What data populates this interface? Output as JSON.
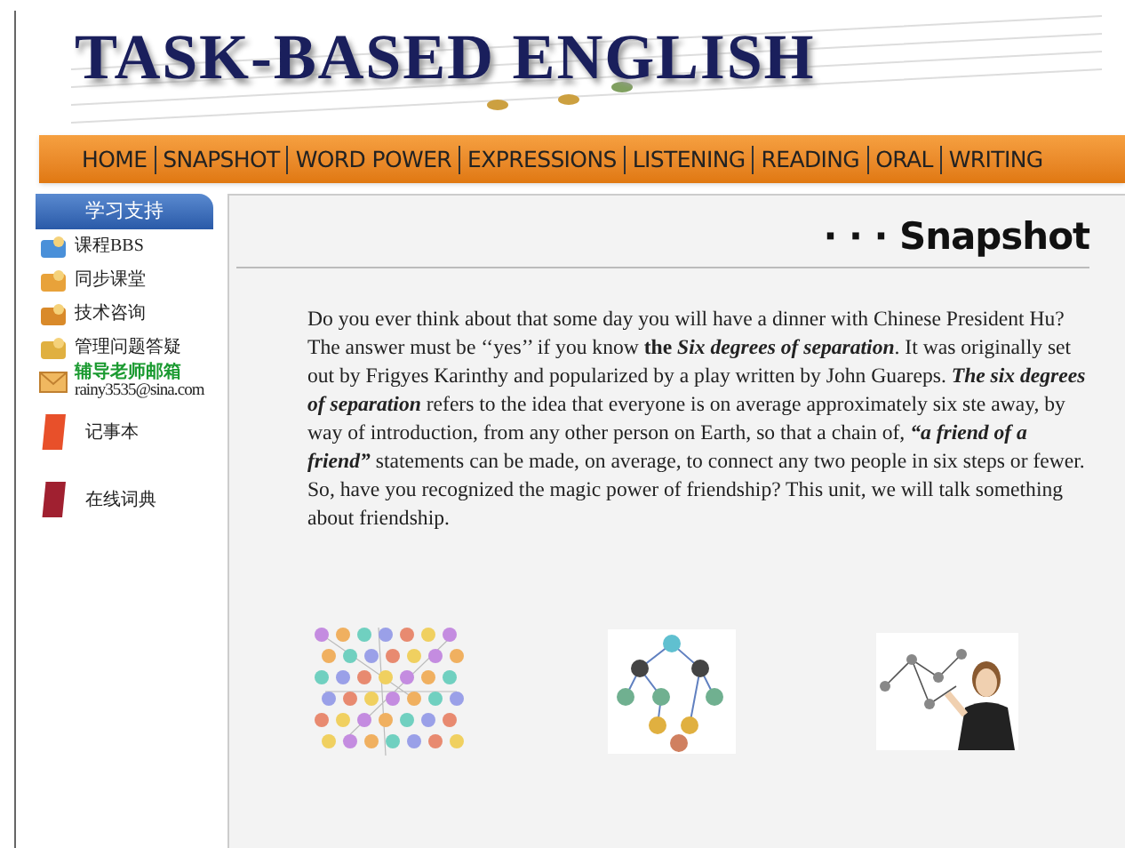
{
  "header": {
    "title": "TASK-BASED ENGLISH"
  },
  "nav": [
    {
      "label": "HOME"
    },
    {
      "label": "SNAPSHOT"
    },
    {
      "label": "WORD POWER"
    },
    {
      "label": "EXPRESSIONS"
    },
    {
      "label": "LISTENING"
    },
    {
      "label": "READING"
    },
    {
      "label": "ORAL"
    },
    {
      "label": "WRITING"
    }
  ],
  "sidebar": {
    "heading": "学习支持",
    "items": [
      {
        "kind": "link",
        "label": "课程BBS",
        "color": "#4a90d9"
      },
      {
        "kind": "link",
        "label": "同步课堂",
        "color": "#e8a23a"
      },
      {
        "kind": "link",
        "label": "技术咨询",
        "color": "#d98a2a"
      },
      {
        "kind": "link",
        "label": "管理问题答疑",
        "color": "#e0b040"
      },
      {
        "kind": "mail",
        "label": "辅导老师邮箱",
        "email": "rainy3535@sina.com",
        "color": "#f0b860"
      },
      {
        "kind": "book",
        "label": "记事本",
        "color": "#e8502a"
      },
      {
        "kind": "book",
        "label": "在线词典",
        "color": "#a02030"
      }
    ]
  },
  "main": {
    "heading": "· · · Snapshot",
    "paragraph": "Do you ever think about that some day you will have a dinner with Chinese President Hu? The answer must be ‘‘yes’’ if you know **the** *Six degrees of separation*. It was originally set out by Frigyes Karinthy and popularized by a play written by John Guareps. *The six degrees of separation* refers to the idea that everyone is on average approximately six ste away, by way of introduction, from any other person on Earth, so that a chain of,  *“a friend of a friend”*  statements can be made, on average, to connect any two people in six steps or fewer. So, have you recognized the magic power of friendship? This unit, we will talk something about friendship."
  }
}
